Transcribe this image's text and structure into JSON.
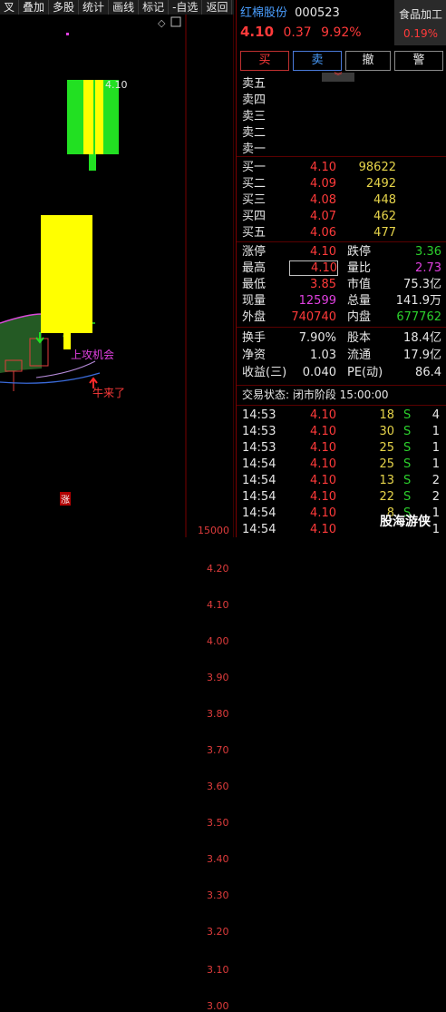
{
  "toolbar": {
    "items": [
      "叉",
      "叠加",
      "多股",
      "统计",
      "画线",
      "标记",
      "-自选",
      "返回"
    ]
  },
  "chart": {
    "price_axis": [
      "4.20",
      "4.10",
      "4.00",
      "3.90",
      "3.80",
      "3.70",
      "3.60",
      "3.50",
      "3.40",
      "3.30",
      "3.20",
      "3.10",
      "3.00"
    ],
    "volume_label": "15000",
    "peak_label": "4.10",
    "annotation_up": "上攻机会",
    "annotation_bull": "牛来了",
    "limit_marker": "涨"
  },
  "header": {
    "name": "红棉股份",
    "code": "000523",
    "industry": "食品加工",
    "price": "4.10",
    "change": "0.37",
    "change_pct": "9.92%",
    "industry_pct": "0.19%"
  },
  "buttons": {
    "buy": "买",
    "sell": "卖",
    "cancel": "撤",
    "alert": "警"
  },
  "asks": [
    {
      "label": "卖五",
      "price": "",
      "vol": ""
    },
    {
      "label": "卖四",
      "price": "",
      "vol": ""
    },
    {
      "label": "卖三",
      "price": "",
      "vol": ""
    },
    {
      "label": "卖二",
      "price": "",
      "vol": ""
    },
    {
      "label": "卖一",
      "price": "",
      "vol": ""
    }
  ],
  "bids": [
    {
      "label": "买一",
      "price": "4.10",
      "vol": "98622"
    },
    {
      "label": "买二",
      "price": "4.09",
      "vol": "2492"
    },
    {
      "label": "买三",
      "price": "4.08",
      "vol": "448"
    },
    {
      "label": "买四",
      "price": "4.07",
      "vol": "462"
    },
    {
      "label": "买五",
      "price": "4.06",
      "vol": "477"
    }
  ],
  "stats": [
    {
      "l1": "涨停",
      "v1": "4.10",
      "l2": "跌停",
      "v2": "3.36"
    },
    {
      "l1": "最高",
      "v1": "4.10",
      "l2": "量比",
      "v2": "2.73"
    },
    {
      "l1": "最低",
      "v1": "3.85",
      "l2": "市值",
      "v2": "75.3亿"
    },
    {
      "l1": "现量",
      "v1": "12599",
      "l2": "总量",
      "v2": "141.9万"
    },
    {
      "l1": "外盘",
      "v1": "740740",
      "l2": "内盘",
      "v2": "677762"
    }
  ],
  "stats2": [
    {
      "l1": "换手",
      "v1": "7.90%",
      "l2": "股本",
      "v2": "18.4亿"
    },
    {
      "l1": "净资",
      "v1": "1.03",
      "l2": "流通",
      "v2": "17.9亿"
    },
    {
      "l1": "收益(三)",
      "v1": "0.040",
      "l2": "PE(动)",
      "v2": "86.4"
    }
  ],
  "trade_status": "交易状态: 闭市阶段 15:00:00",
  "trades": [
    {
      "time": "14:53",
      "price": "4.10",
      "vol": "18",
      "side": "S",
      "n": "4"
    },
    {
      "time": "14:53",
      "price": "4.10",
      "vol": "30",
      "side": "S",
      "n": "1"
    },
    {
      "time": "14:53",
      "price": "4.10",
      "vol": "25",
      "side": "S",
      "n": "1"
    },
    {
      "time": "14:54",
      "price": "4.10",
      "vol": "25",
      "side": "S",
      "n": "1"
    },
    {
      "time": "14:54",
      "price": "4.10",
      "vol": "13",
      "side": "S",
      "n": "2"
    },
    {
      "time": "14:54",
      "price": "4.10",
      "vol": "22",
      "side": "S",
      "n": "2"
    },
    {
      "time": "14:54",
      "price": "4.10",
      "vol": "8",
      "side": "S",
      "n": "1"
    },
    {
      "time": "14:54",
      "price": "4.10",
      "vol": "",
      "side": "",
      "n": "1"
    }
  ],
  "watermark": "股海游侠",
  "colors": {
    "up": "#ff3a3a",
    "down": "#2cd02c",
    "candle_up": "#ffff00",
    "candle_green": "#22e022"
  }
}
